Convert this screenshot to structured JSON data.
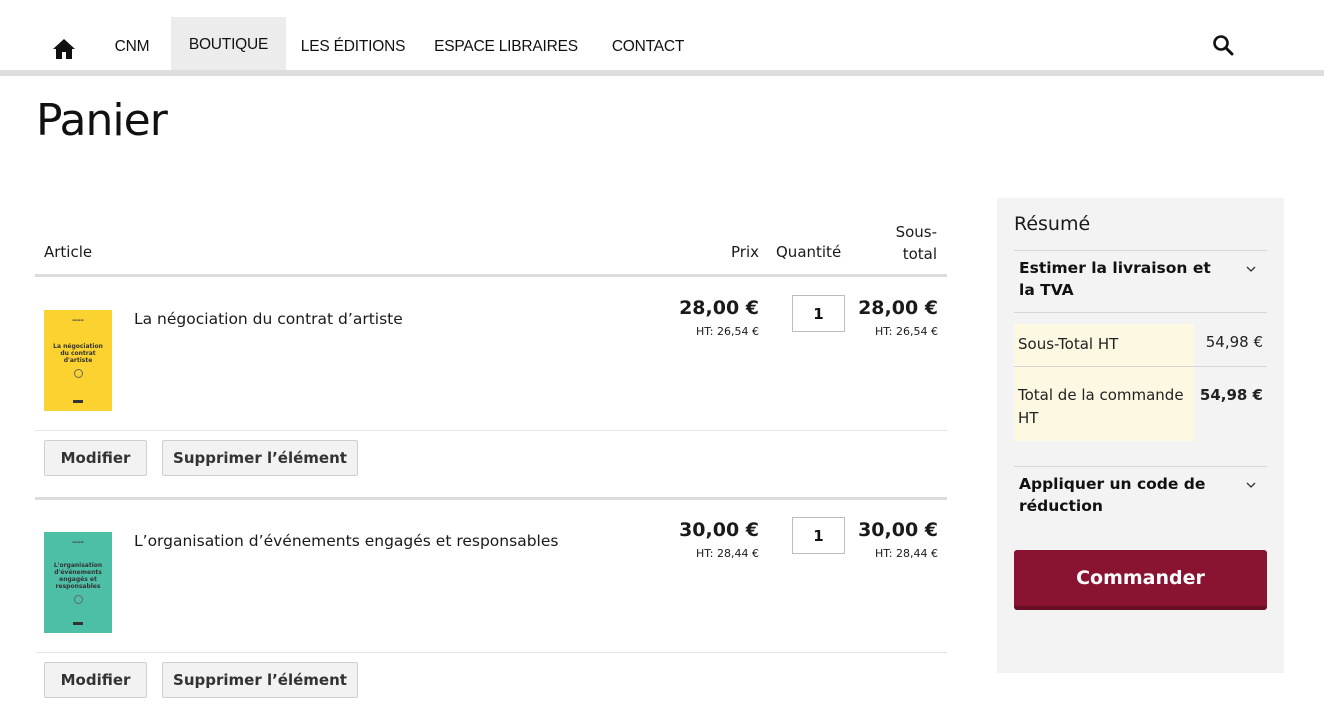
{
  "nav": {
    "home_icon": "home-icon",
    "items": [
      {
        "label": "CNM",
        "active": false
      },
      {
        "label": "BOUTIQUE",
        "active": true
      },
      {
        "label": "LES ÉDITIONS",
        "active": false
      },
      {
        "label": "ESPACE LIBRAIRES",
        "active": false
      },
      {
        "label": "CONTACT",
        "active": false
      }
    ],
    "search_icon": "search-icon",
    "accent": "#8a1331"
  },
  "page_title": "Panier",
  "cart": {
    "headers": {
      "article": "Article",
      "price": "Prix",
      "quantity": "Quantité",
      "subtotal_line1": "Sous-",
      "subtotal_line2": "total"
    },
    "items": [
      {
        "name": "La négociation du contrat d’artiste",
        "cover_color": "#fbd22f",
        "cover_title": "La négociation du contrat d'artiste",
        "price": "28,00 €",
        "price_ht": "HT: 26,54 €",
        "qty": "1",
        "subtotal": "28,00 €",
        "subtotal_ht": "HT: 26,54 €",
        "edit_label": "Modifier",
        "delete_label": "Supprimer l’élément"
      },
      {
        "name": "L’organisation d’événements engagés et responsables",
        "cover_color": "#4dbfa6",
        "cover_title": "L'organisation d'événements engagés et responsables",
        "price": "30,00 €",
        "price_ht": "HT: 28,44 €",
        "qty": "1",
        "subtotal": "30,00 €",
        "subtotal_ht": "HT: 28,44 €",
        "edit_label": "Modifier",
        "delete_label": "Supprimer l’élément"
      }
    ]
  },
  "summary": {
    "title": "Résumé",
    "shipping_label": "Estimer la livraison et la TVA",
    "subtotal_label": "Sous-Total HT",
    "subtotal_value": "54,98 €",
    "total_label": "Total de la commande HT",
    "total_value": "54,98 €",
    "coupon_label": "Appliquer un code de réduction",
    "order_label": "Commander",
    "order_color": "#8a1331"
  }
}
